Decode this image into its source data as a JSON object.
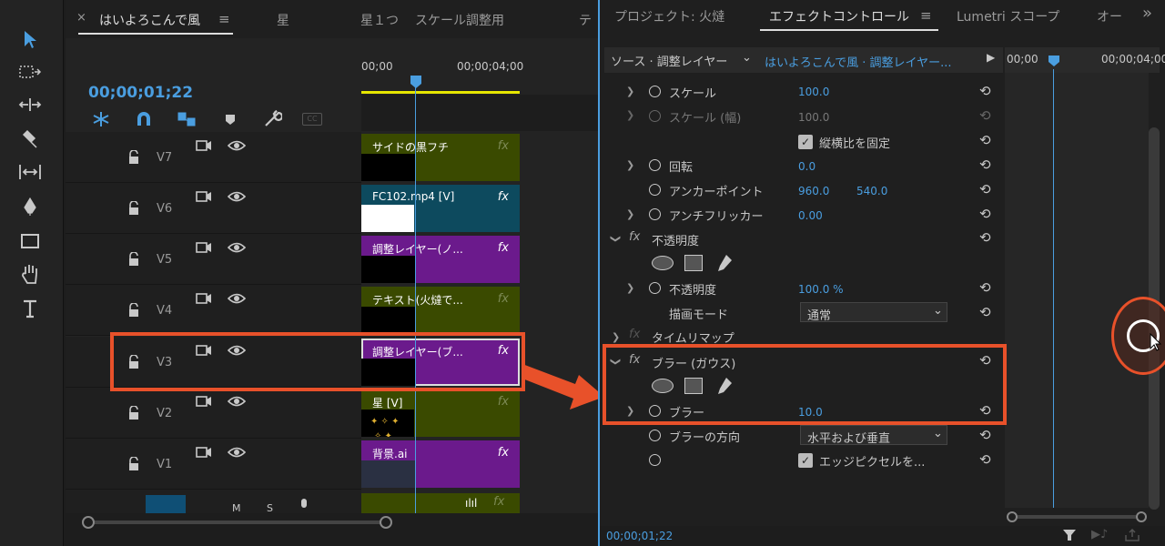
{
  "timeline": {
    "close_icon": "×",
    "tabs": [
      "はいよろこんで風",
      "星",
      "星１つ",
      "スケール調整用",
      "テ"
    ],
    "timecode": "00;00;01;22",
    "ruler": [
      "00;00",
      "00;00;04;00"
    ],
    "tracks": [
      {
        "label": "V7",
        "clip": "サイドの黒フチ"
      },
      {
        "label": "V6",
        "clip": "FC102.mp4 [V]"
      },
      {
        "label": "V5",
        "clip": "調整レイヤー(ノ..."
      },
      {
        "label": "V4",
        "clip": "テキスト(火燵で..."
      },
      {
        "label": "V3",
        "clip": "調整レイヤー(ブ..."
      },
      {
        "label": "V2",
        "clip": "星 [V]"
      },
      {
        "label": "V1",
        "source": "V1",
        "clip": "背景.ai"
      }
    ],
    "audio": {
      "m": "M",
      "s": "S"
    },
    "fx_label": "fx"
  },
  "panel": {
    "tabs": [
      "プロジェクト: 火燵",
      "エフェクトコントロール",
      "Lumetri スコープ",
      "オー"
    ],
    "more": "»",
    "source_label": "ソース · 調整レイヤー",
    "source_target": "はいよろこんで風 · 調整レイヤー...",
    "mini_ruler": [
      "00;00",
      "00;00;04;00"
    ],
    "rows": {
      "scale": {
        "label": "スケール",
        "value": "100.0"
      },
      "scale_w": {
        "label": "スケール (幅)",
        "value": "100.0"
      },
      "uniform": "縦横比を固定",
      "rotation": {
        "label": "回転",
        "value": "0.0"
      },
      "anchor": {
        "label": "アンカーポイント",
        "x": "960.0",
        "y": "540.0"
      },
      "antiflicker": {
        "label": "アンチフリッカー",
        "value": "0.00"
      },
      "opacity_section": "不透明度",
      "opacity": {
        "label": "不透明度",
        "value": "100.0 %"
      },
      "blend": {
        "label": "描画モード",
        "value": "通常"
      },
      "timeremap": "タイムリマップ",
      "blur_section": "ブラー (ガウス)",
      "blur": {
        "label": "ブラー",
        "value": "10.0"
      },
      "blur_dir": {
        "label": "ブラーの方向",
        "value": "水平および垂直"
      },
      "edge": "エッジピクセルを..."
    },
    "footer_tc": "00;00;01;22"
  },
  "colors": {
    "accent": "#4a9ee0",
    "highlight": "#e8512a",
    "clip_green": "#3a4a00",
    "clip_purple": "#6b1a8c",
    "clip_teal": "#0d4a5e"
  }
}
